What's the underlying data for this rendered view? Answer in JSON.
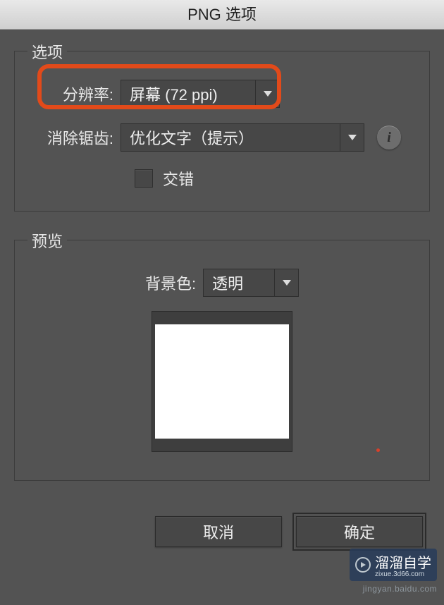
{
  "window": {
    "title": "PNG 选项"
  },
  "options": {
    "group_label": "选项",
    "resolution_label": "分辨率:",
    "resolution_value": "屏幕 (72 ppi)",
    "antialias_label": "消除锯齿:",
    "antialias_value": "优化文字（提示）",
    "interlaced_label": "交错",
    "interlaced_checked": false
  },
  "preview": {
    "group_label": "预览",
    "bgcolor_label": "背景色:",
    "bgcolor_value": "透明"
  },
  "buttons": {
    "cancel": "取消",
    "ok": "确定"
  },
  "icons": {
    "info": "i",
    "dropdown_arrow": "▼"
  },
  "watermark": {
    "brand": "溜溜自学",
    "domain": "zixue.3d66.com",
    "url": "jingyan.baidu.com"
  }
}
